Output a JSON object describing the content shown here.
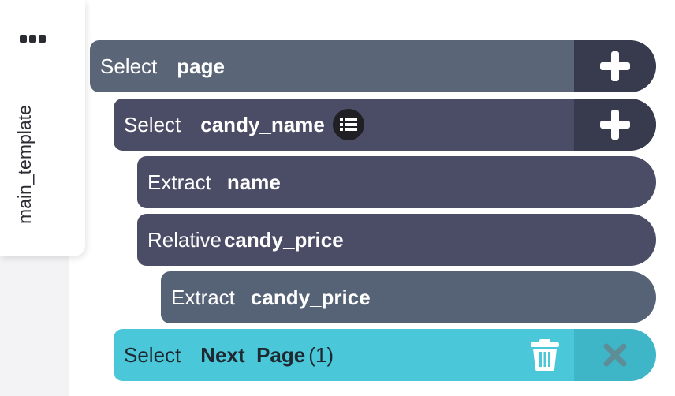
{
  "sidebar": {
    "menu_icon": "dots-icon",
    "title": "main_template"
  },
  "colors": {
    "node_dark_slate": "#5a6677",
    "node_dark_purple": "#4b4c66",
    "node_slate_alt": "#566275",
    "action_bg": "#383a4d",
    "highlight": "#4ac7d8",
    "highlight_action": "#3fb6c8",
    "delete_x": "#5d8e98"
  },
  "nodes": [
    {
      "keyword": "Select",
      "name": "page",
      "icon": "plus-icon"
    },
    {
      "keyword": "Select",
      "name": "candy_name",
      "badge_icon": "list-icon",
      "icon": "plus-icon"
    },
    {
      "keyword": "Extract",
      "name": "name"
    },
    {
      "keyword": "Relative",
      "name": "candy_price"
    },
    {
      "keyword": "Extract",
      "name": "candy_price"
    },
    {
      "keyword": "Select",
      "name": "Next_Page",
      "count": "(1)",
      "icons": [
        "trash-icon",
        "close-icon"
      ]
    }
  ]
}
